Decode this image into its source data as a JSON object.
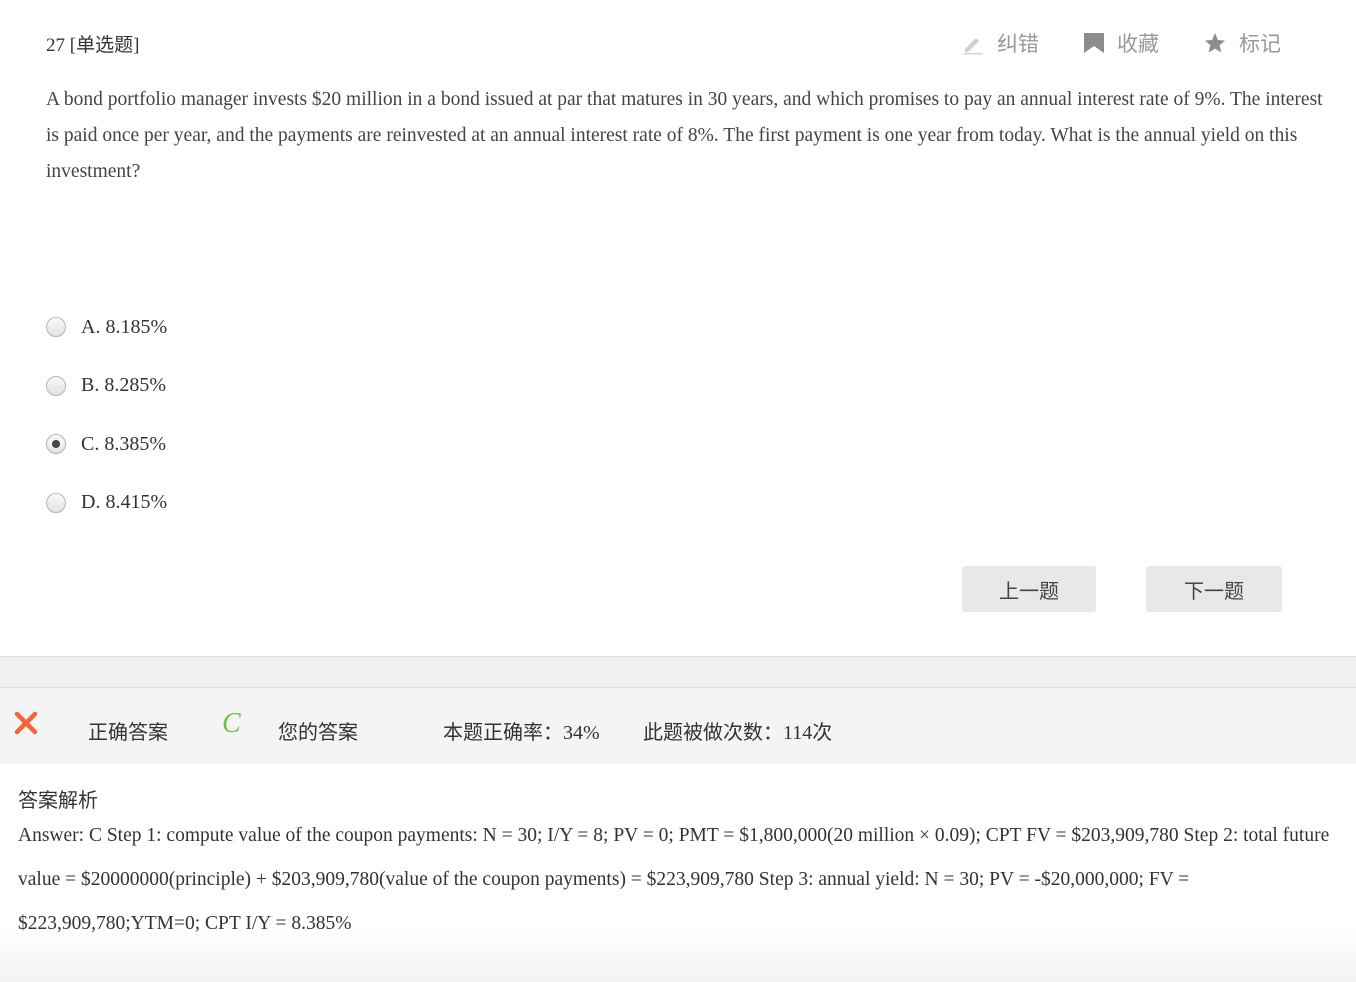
{
  "question": {
    "number_type": "27 [单选题]",
    "text": "A bond portfolio manager invests $20 million in a bond issued at par that matures in 30 years, and which promises to pay an annual interest rate of 9%. The interest is paid once per year, and the payments are reinvested at an annual interest rate of 8%. The first payment is one year from today. What is the annual yield on this investment?",
    "options": [
      {
        "label": "A. 8.185%",
        "checked": false
      },
      {
        "label": "B. 8.285%",
        "checked": false
      },
      {
        "label": "C. 8.385%",
        "checked": true
      },
      {
        "label": "D. 8.415%",
        "checked": false
      }
    ]
  },
  "toolbar": {
    "correct_label": "纠错",
    "favorite_label": "收藏",
    "mark_label": "标记",
    "icon_color": "#aaaaaa"
  },
  "navigation": {
    "prev_label": "上一题",
    "next_label": "下一题"
  },
  "result": {
    "correct_answer_label": "正确答案",
    "correct_answer_value": "C",
    "your_answer_label": "您的答案",
    "accuracy_text": "本题正确率：34%",
    "attempts_text": "此题被做次数：114次",
    "wrong_icon": "cross-icon",
    "wrong_color": "#f2663a",
    "correct_color": "#6cc04a"
  },
  "analysis": {
    "title": "答案解析",
    "text": "Answer: C Step 1: compute value of the coupon payments: N = 30; I/Y = 8; PV = 0; PMT = $1,800,000(20 million × 0.09); CPT FV = $203,909,780 Step 2: total future value = $20000000(principle) + $203,909,780(value of the coupon payments) = $223,909,780 Step 3: annual yield: N = 30; PV = -$20,000,000; FV = $223,909,780;YTM=0; CPT I/Y = 8.385%"
  }
}
